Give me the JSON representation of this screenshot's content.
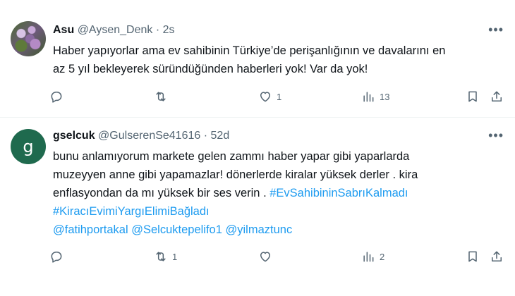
{
  "tweets": [
    {
      "name": "Asu",
      "handle": "@Aysen_Denk",
      "separator": "·",
      "time": "2s",
      "text_lines": [
        "Haber yapıyorlar  ama ev sahibinin Türkiye’de perişanlığının ve davalarını  en",
        "az 5 yıl bekleyerek süründüğünden haberleri yok! Var da yok!"
      ],
      "counts": {
        "reply": "",
        "retweet": "",
        "like": "1",
        "views": "13"
      }
    },
    {
      "name": "gselcuk",
      "handle": "@GulserenSe41616",
      "separator": "·",
      "time": "52d",
      "avatar_letter": "g",
      "text_lines": [
        "bunu anlamıyorum markete gelen zammı haber yapar gibi yaparlarda",
        "muzeyyen anne gibi yapamazlar! dönerlerde kiralar yüksek derler . kira",
        "enflasyondan da mı yüksek bir ses verin . "
      ],
      "hashtags": [
        "#EvSahibininSabrıKalmadı",
        "#KiracıEvimiYargıElimiBağladı"
      ],
      "mentions": [
        "@fatihportakal",
        "@Selcuktepelifo1",
        "@yilmaztunc"
      ],
      "counts": {
        "reply": "",
        "retweet": "1",
        "like": "",
        "views": "2"
      }
    }
  ],
  "icons": [
    "more-icon",
    "reply-icon",
    "retweet-icon",
    "like-icon",
    "views-icon",
    "bookmark-icon",
    "share-icon"
  ],
  "colors": {
    "link": "#1d9bf0",
    "secondary": "#536471",
    "text": "#0f1419",
    "avatar_bg": "#1f6a4e"
  }
}
